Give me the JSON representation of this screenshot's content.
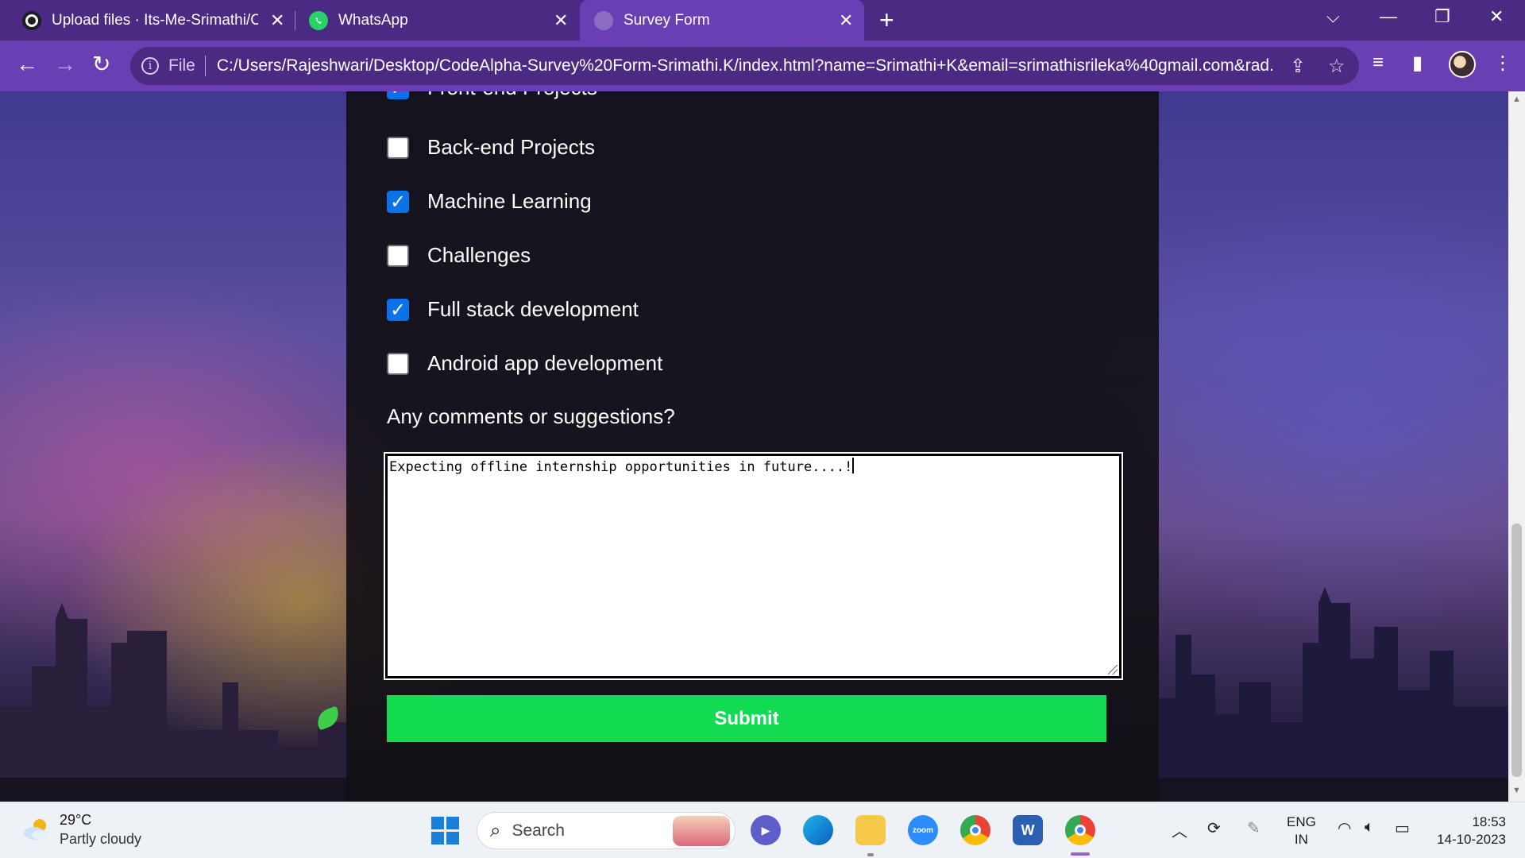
{
  "browser": {
    "tabs": [
      {
        "title": "Upload files · Its-Me-Srimathi/Co",
        "favicon": "github-icon",
        "active": false
      },
      {
        "title": "WhatsApp",
        "favicon": "whatsapp-icon",
        "active": false
      },
      {
        "title": "Survey Form",
        "favicon": "globe-icon",
        "active": true
      }
    ],
    "new_tab_label": "+",
    "address": {
      "scheme_label": "File",
      "url": "C:/Users/Rajeshwari/Desktop/CodeAlpha-Survey%20Form-Srimathi.K/index.html?name=Srimathi+K&email=srimathisrileka%40gmail.com&rad..."
    }
  },
  "form": {
    "options": [
      {
        "label": "Front-end Projects",
        "checked": true
      },
      {
        "label": "Back-end Projects",
        "checked": false
      },
      {
        "label": "Machine Learning",
        "checked": true
      },
      {
        "label": "Challenges",
        "checked": false
      },
      {
        "label": "Full stack development",
        "checked": true
      },
      {
        "label": "Android app development",
        "checked": false
      }
    ],
    "comments_label": "Any comments or suggestions?",
    "comments_value": "Expecting offline internship opportunities in future....!",
    "submit_label": "Submit"
  },
  "taskbar": {
    "weather": {
      "temp": "29°C",
      "desc": "Partly cloudy"
    },
    "search_placeholder": "Search",
    "apps": [
      "teams-icon",
      "edge-icon",
      "file-explorer-icon",
      "zoom-icon",
      "chrome-icon",
      "word-icon",
      "chrome-profile-icon"
    ],
    "zoom_label": "zoom",
    "word_label": "W",
    "language": {
      "line1": "ENG",
      "line2": "IN"
    },
    "time": "18:53",
    "date": "14-10-2023"
  },
  "colors": {
    "tabbar": "#4b2a84",
    "toolbar": "#6a3fb3",
    "checkbox_checked": "#0b72e7",
    "submit": "#12db52"
  }
}
